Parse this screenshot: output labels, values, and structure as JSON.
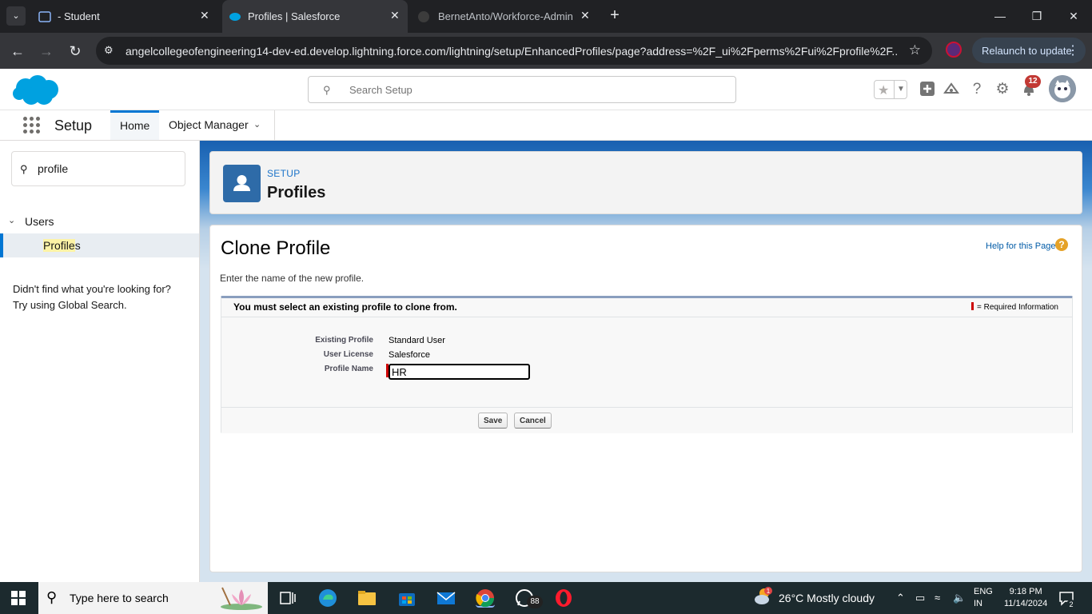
{
  "browser": {
    "tabs": [
      {
        "title": "- Student",
        "active": false
      },
      {
        "title": "Profiles | Salesforce",
        "active": true
      },
      {
        "title": "BernetAnto/Workforce-Adminis",
        "active": false
      }
    ],
    "url": "angelcollegeofengineering14-dev-ed.develop.lightning.force.com/lightning/setup/EnhancedProfiles/page?address=%2F_ui%2Fperms%2Fui%2Fprofile%2F...",
    "relaunch_label": "Relaunch to update"
  },
  "header": {
    "search_placeholder": "Search Setup",
    "notification_count": "12"
  },
  "nav": {
    "app_name": "Setup",
    "tabs": [
      {
        "label": "Home",
        "active": true
      },
      {
        "label": "Object Manager",
        "active": false
      }
    ]
  },
  "sidebar": {
    "quickfind_value": "profile",
    "group": "Users",
    "item_highlight": "Profile",
    "item_rest": "s",
    "help_line1": "Didn't find what you're looking for?",
    "help_line2": "Try using Global Search."
  },
  "page_header": {
    "kicker": "SETUP",
    "title": "Profiles"
  },
  "content": {
    "title": "Clone Profile",
    "help_link": "Help for this Page",
    "intro": "Enter the name of the new profile.",
    "section_message": "You must select an existing profile to clone from.",
    "required_info": "= Required Information",
    "fields": {
      "existing_profile_label": "Existing Profile",
      "existing_profile_value": "Standard User",
      "user_license_label": "User License",
      "user_license_value": "Salesforce",
      "profile_name_label": "Profile Name",
      "profile_name_value": "HR"
    },
    "save_label": "Save",
    "cancel_label": "Cancel"
  },
  "taskbar": {
    "search_placeholder": "Type here to search",
    "whatsapp_badge": "88",
    "weather": "26°C  Mostly cloudy",
    "weather_alert": "1",
    "lang_line1": "ENG",
    "lang_line2": "IN",
    "time": "9:18 PM",
    "date": "11/14/2024",
    "notifications": "2"
  },
  "colors": {
    "salesforce_blue": "#0176d3",
    "required_red": "#c23934"
  }
}
